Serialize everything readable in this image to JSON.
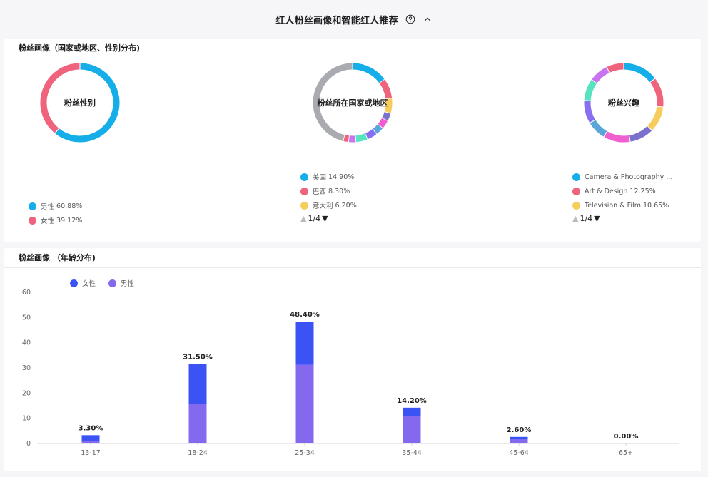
{
  "header": {
    "title": "红人粉丝画像和智能红人推荐"
  },
  "country_card": {
    "title": "粉丝画像（国家或地区、性别分布)",
    "gender": {
      "center_label": "粉丝性别",
      "segments": [
        {
          "label": "男性",
          "value": "60.88%",
          "pct": 60.88,
          "color": "#15aee8"
        },
        {
          "label": "女性",
          "value": "39.12%",
          "pct": 39.12,
          "color": "#f0637c"
        }
      ]
    },
    "region": {
      "center_label": "粉丝所在国家或地区",
      "segments": [
        {
          "pct": 14.9,
          "color": "#15aee8"
        },
        {
          "pct": 8.3,
          "color": "#f0637c"
        },
        {
          "pct": 6.2,
          "color": "#f6cd5c"
        },
        {
          "pct": 3.2,
          "color": "#7a71cc"
        },
        {
          "pct": 3.6,
          "color": "#f05fcf"
        },
        {
          "pct": 3.4,
          "color": "#5aa6d9"
        },
        {
          "pct": 4.2,
          "color": "#8a6ef0"
        },
        {
          "pct": 4.8,
          "color": "#57e3c0"
        },
        {
          "pct": 3.0,
          "color": "#c874ee"
        },
        {
          "pct": 2.2,
          "color": "#ef637c"
        },
        {
          "pct": 46.2,
          "color": "#a9abb1"
        }
      ],
      "legend": [
        {
          "label": "美国",
          "value": "14.90%",
          "color": "#15aee8"
        },
        {
          "label": "巴西",
          "value": "8.30%",
          "color": "#f0637c"
        },
        {
          "label": "意大利",
          "value": "6.20%",
          "color": "#f6cd5c"
        }
      ],
      "pager": "1/4"
    },
    "interest": {
      "center_label": "粉丝兴趣",
      "segments": [
        {
          "pct": 14.5,
          "color": "#15aee8"
        },
        {
          "pct": 12.25,
          "color": "#f0637c"
        },
        {
          "pct": 10.65,
          "color": "#f6cd5c"
        },
        {
          "pct": 10.0,
          "color": "#7a71cc"
        },
        {
          "pct": 11.0,
          "color": "#f05fcf"
        },
        {
          "pct": 8.0,
          "color": "#5aa6d9"
        },
        {
          "pct": 9.5,
          "color": "#8a6ef0"
        },
        {
          "pct": 9.0,
          "color": "#57e3c0"
        },
        {
          "pct": 8.0,
          "color": "#c874ee"
        },
        {
          "pct": 7.1,
          "color": "#ef637c"
        }
      ],
      "legend": [
        {
          "label": "Camera & Photography ...",
          "value": "",
          "color": "#15aee8"
        },
        {
          "label": "Art & Design",
          "value": "12.25%",
          "color": "#f0637c"
        },
        {
          "label": "Television & Film",
          "value": "10.65%",
          "color": "#f6cd5c"
        }
      ],
      "pager": "1/4"
    }
  },
  "age_card": {
    "title": "粉丝画像  （年龄分布)",
    "legend": [
      {
        "label": "女性",
        "color": "#3b53f5"
      },
      {
        "label": "男性",
        "color": "#8468ee"
      }
    ]
  },
  "chart_data": {
    "type": "bar",
    "stacked": true,
    "categories": [
      "13-17",
      "18-24",
      "25-34",
      "35-44",
      "45-64",
      "65+"
    ],
    "series": [
      {
        "name": "男性",
        "color": "#8468ee",
        "values": [
          1.0,
          15.7,
          31.2,
          10.8,
          1.6,
          0
        ]
      },
      {
        "name": "女性",
        "color": "#3b53f5",
        "values": [
          2.3,
          15.8,
          17.2,
          3.4,
          1.0,
          0
        ]
      }
    ],
    "data_labels": [
      "3.30%",
      "31.50%",
      "48.40%",
      "14.20%",
      "2.60%",
      "0.00%"
    ],
    "totals": [
      3.3,
      31.5,
      48.4,
      14.2,
      2.6,
      0
    ],
    "yticks": [
      0,
      10,
      20,
      30,
      40,
      50,
      60
    ],
    "ylim": [
      0,
      60
    ],
    "grid": false
  }
}
